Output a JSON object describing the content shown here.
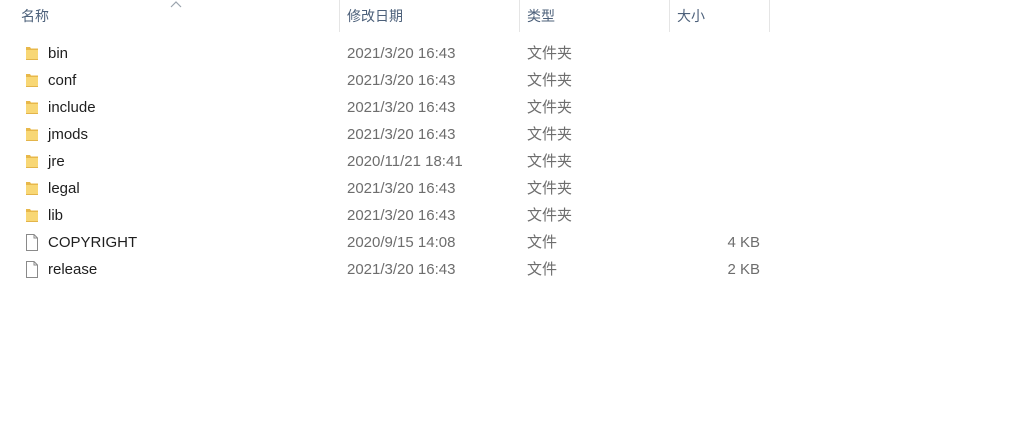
{
  "columns": {
    "name": "名称",
    "date": "修改日期",
    "type": "类型",
    "size": "大小"
  },
  "sort": {
    "column": "name",
    "direction": "ascending",
    "icon": "chevron-up-icon"
  },
  "files": [
    {
      "name": "bin",
      "date": "2021/3/20 16:43",
      "type": "文件夹",
      "size": "",
      "icon": "folder-icon"
    },
    {
      "name": "conf",
      "date": "2021/3/20 16:43",
      "type": "文件夹",
      "size": "",
      "icon": "folder-icon"
    },
    {
      "name": "include",
      "date": "2021/3/20 16:43",
      "type": "文件夹",
      "size": "",
      "icon": "folder-icon"
    },
    {
      "name": "jmods",
      "date": "2021/3/20 16:43",
      "type": "文件夹",
      "size": "",
      "icon": "folder-icon"
    },
    {
      "name": "jre",
      "date": "2020/11/21 18:41",
      "type": "文件夹",
      "size": "",
      "icon": "folder-icon"
    },
    {
      "name": "legal",
      "date": "2021/3/20 16:43",
      "type": "文件夹",
      "size": "",
      "icon": "folder-icon"
    },
    {
      "name": "lib",
      "date": "2021/3/20 16:43",
      "type": "文件夹",
      "size": "",
      "icon": "folder-icon"
    },
    {
      "name": "COPYRIGHT",
      "date": "2020/9/15 14:08",
      "type": "文件",
      "size": "4 KB",
      "icon": "file-icon"
    },
    {
      "name": "release",
      "date": "2021/3/20 16:43",
      "type": "文件",
      "size": "2 KB",
      "icon": "file-icon"
    }
  ],
  "colors": {
    "folder_front": "#f8d775",
    "folder_back": "#e8b84a",
    "header_text": "#4c607a"
  }
}
